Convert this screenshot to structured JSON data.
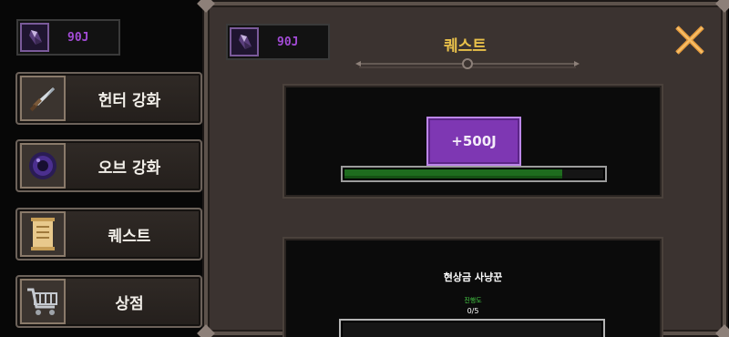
{
  "sidebar": {
    "currency": {
      "icon": "purple-gem-icon",
      "value": "90J"
    },
    "menu": [
      {
        "label": "헌터 강화",
        "icon": "dagger-icon"
      },
      {
        "label": "오브 강화",
        "icon": "dark-orb-icon"
      },
      {
        "label": "퀘스트",
        "icon": "scroll-icon"
      },
      {
        "label": "상점",
        "icon": "cart-icon"
      }
    ]
  },
  "panel": {
    "currency": {
      "icon": "purple-gem-icon",
      "value": "90J"
    },
    "title": "퀘스트",
    "close_icon": "close-x-icon",
    "reward": {
      "label": "+500J",
      "progress": 0.84
    },
    "quest": {
      "name": "현상금 사냥꾼",
      "progress_label": "진행도",
      "count": "0/5"
    }
  },
  "colors": {
    "accent_gold": "#e8c04a",
    "gem_purple": "#a24bd6",
    "progress_green": "#1e6c1e",
    "reward_purple": "#7e37b3"
  }
}
